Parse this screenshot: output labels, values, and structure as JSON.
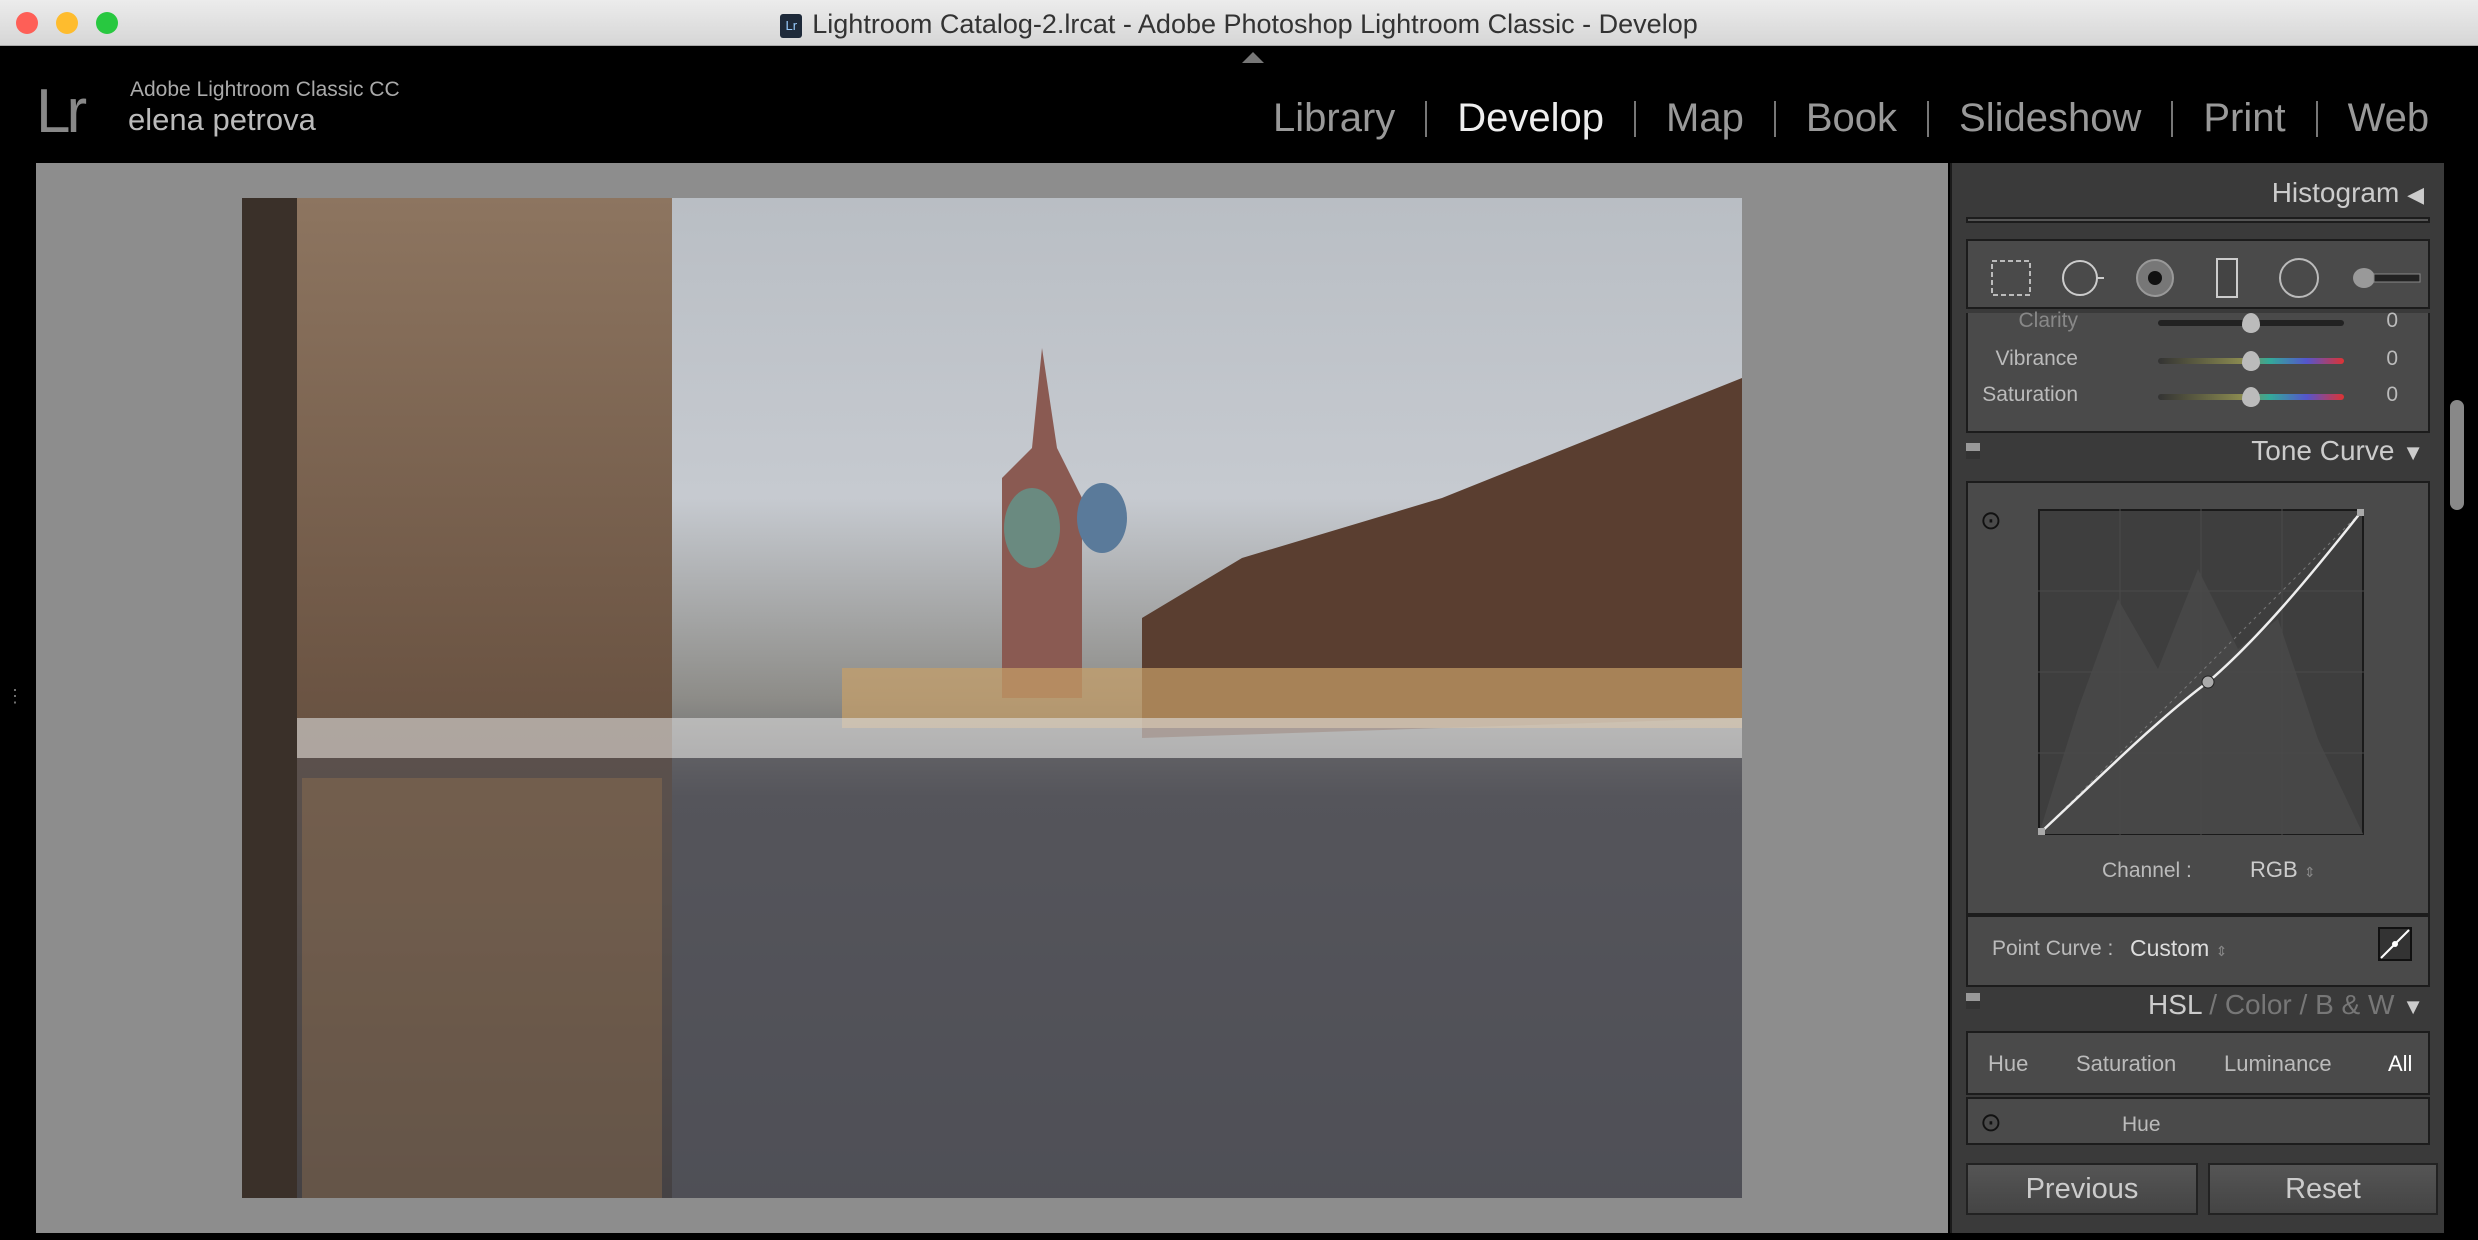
{
  "window": {
    "title": "Lightroom Catalog-2.lrcat - Adobe Photoshop Lightroom Classic - Develop",
    "traffic_lights": [
      "#fe5f57",
      "#febc2e",
      "#28c840"
    ]
  },
  "header": {
    "logo": "Lr",
    "app_name": "Adobe Lightroom Classic CC",
    "user": "elena petrova",
    "modules": [
      {
        "label": "Library"
      },
      {
        "label": "Develop",
        "active": true
      },
      {
        "label": "Map"
      },
      {
        "label": "Book"
      },
      {
        "label": "Slideshow"
      },
      {
        "label": "Print"
      },
      {
        "label": "Web"
      }
    ]
  },
  "panel": {
    "histogram": {
      "title": "Histogram"
    },
    "tools": [
      "crop-overlay-icon",
      "spot-removal-icon",
      "red-eye-icon",
      "graduated-filter-icon",
      "radial-filter-icon",
      "adjustment-brush-icon"
    ],
    "sliders": [
      {
        "label": "Clarity",
        "value": "0"
      },
      {
        "label": "Vibrance",
        "value": "0"
      },
      {
        "label": "Saturation",
        "value": "0"
      }
    ],
    "tone_curve": {
      "title": "Tone Curve",
      "channel_label": "Channel :",
      "channel": "RGB",
      "point_curve_label": "Point Curve :",
      "point_curve": "Custom"
    },
    "hsl": {
      "hsl": "HSL",
      "sep": "/",
      "color": "Color",
      "bw": "B & W",
      "tabs": [
        "Hue",
        "Saturation",
        "Luminance",
        "All"
      ],
      "section": "Hue"
    },
    "buttons": {
      "previous": "Previous",
      "reset": "Reset"
    }
  }
}
